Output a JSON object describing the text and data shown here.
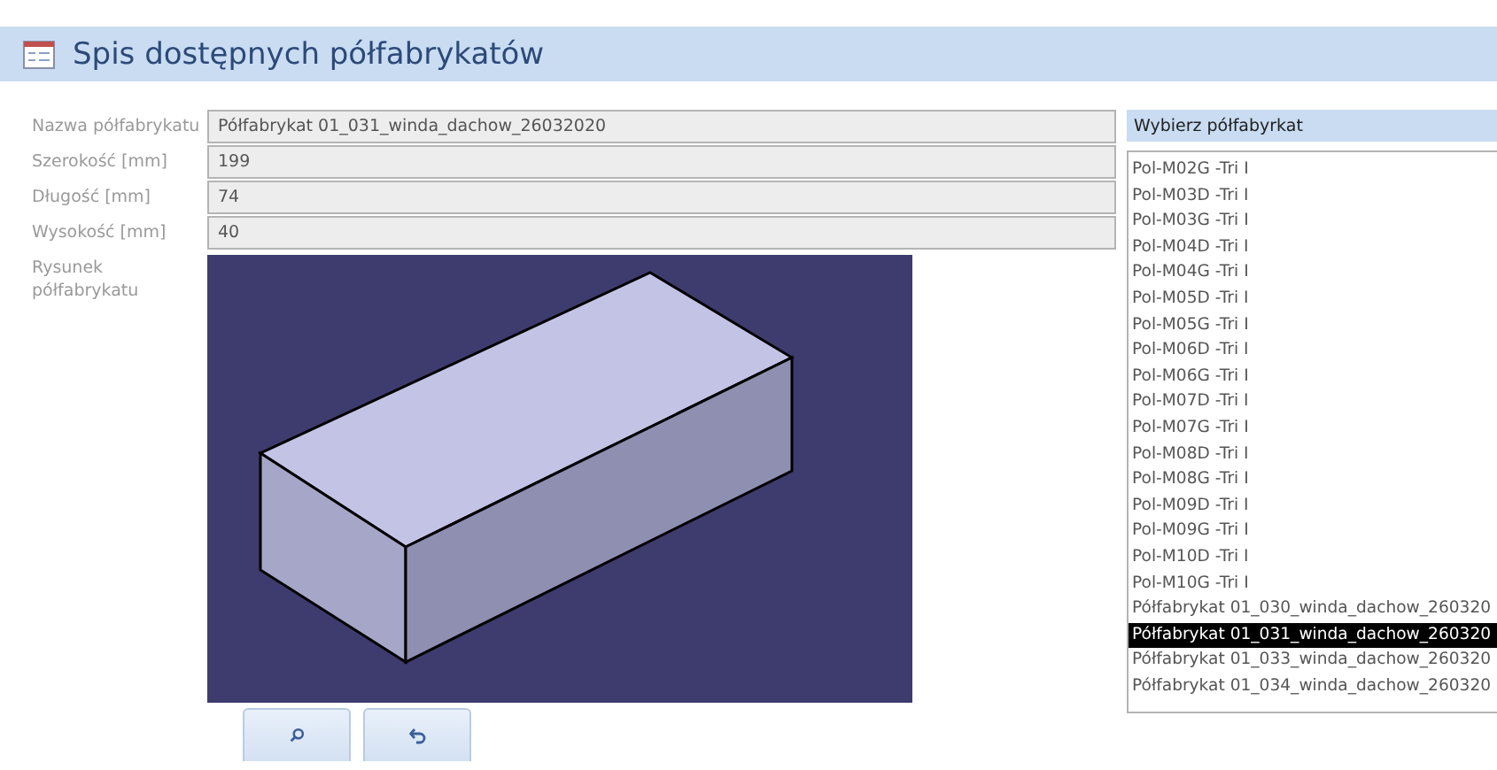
{
  "header": {
    "title": "Spis dostępnych półfabrykatów"
  },
  "fields": [
    {
      "label": "Nazwa półfabrykatu",
      "value": "Półfabrykat 01_031_winda_dachow_26032020"
    },
    {
      "label": "Szerokość [mm]",
      "value": "199"
    },
    {
      "label": "Długość [mm]",
      "value": "74"
    },
    {
      "label": "Wysokość [mm]",
      "value": "40"
    }
  ],
  "drawing": {
    "label": "Rysunek półfabrykatu",
    "kind": "picture"
  },
  "list": {
    "title": "Wybierz półfabyrkat",
    "items": [
      {
        "label": "Pol-M02G -Tri I",
        "selected": false
      },
      {
        "label": "Pol-M03D -Tri I",
        "selected": false
      },
      {
        "label": "Pol-M03G -Tri I",
        "selected": false
      },
      {
        "label": "Pol-M04D -Tri I",
        "selected": false
      },
      {
        "label": "Pol-M04G -Tri I",
        "selected": false
      },
      {
        "label": "Pol-M05D -Tri I",
        "selected": false
      },
      {
        "label": "Pol-M05G -Tri I",
        "selected": false
      },
      {
        "label": "Pol-M06D -Tri I",
        "selected": false
      },
      {
        "label": "Pol-M06G -Tri I",
        "selected": false
      },
      {
        "label": "Pol-M07D -Tri I",
        "selected": false
      },
      {
        "label": "Pol-M07G -Tri I",
        "selected": false
      },
      {
        "label": "Pol-M08D -Tri I",
        "selected": false
      },
      {
        "label": "Pol-M08G -Tri I",
        "selected": false
      },
      {
        "label": "Pol-M09D -Tri I",
        "selected": false
      },
      {
        "label": "Pol-M09G -Tri I",
        "selected": false
      },
      {
        "label": "Pol-M10D -Tri I",
        "selected": false
      },
      {
        "label": "Pol-M10G -Tri I",
        "selected": false
      },
      {
        "label": "Półfabrykat 01_030_winda_dachow_260320",
        "selected": false
      },
      {
        "label": "Półfabrykat 01_031_winda_dachow_260320",
        "selected": true
      },
      {
        "label": "Półfabrykat 01_033_winda_dachow_260320",
        "selected": false
      },
      {
        "label": "Półfabrykat 01_034_winda_dachow_260320",
        "selected": false
      }
    ]
  },
  "buttons": [
    {
      "kind": "search"
    },
    {
      "kind": "undo"
    }
  ]
}
